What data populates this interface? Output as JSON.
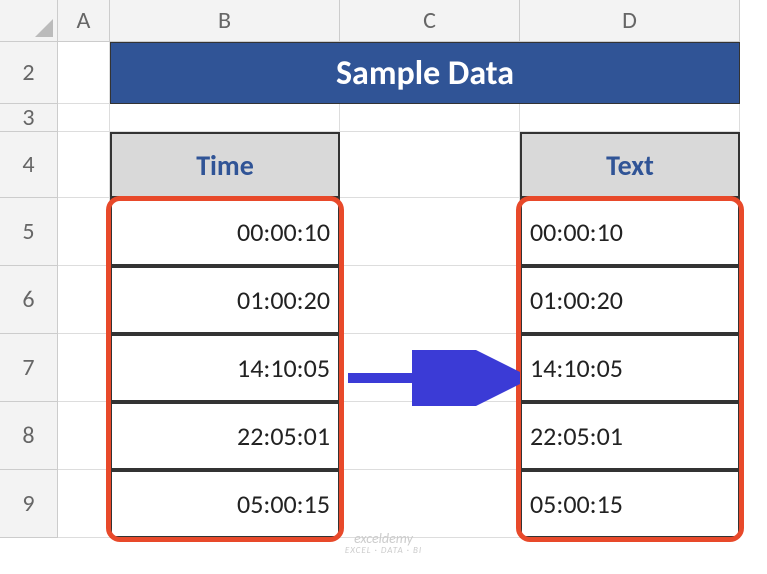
{
  "columns": [
    "A",
    "B",
    "C",
    "D"
  ],
  "rows": [
    "2",
    "3",
    "4",
    "5",
    "6",
    "7",
    "8",
    "9"
  ],
  "title": "Sample Data",
  "headers": {
    "time": "Time",
    "text": "Text"
  },
  "time_values": [
    "00:00:10",
    "01:00:20",
    "14:10:05",
    "22:05:01",
    "05:00:15"
  ],
  "text_values": [
    "00:00:10",
    "01:00:20",
    "14:10:05",
    "22:05:01",
    "05:00:15"
  ],
  "watermark": {
    "line1": "exceldemy",
    "line2": "EXCEL · DATA · BI"
  },
  "col_widths": {
    "A": 52,
    "B": 230,
    "C": 180,
    "D": 220
  },
  "row_heights": {
    "2": 62,
    "3": 28,
    "4": 66,
    "5": 68,
    "6": 68,
    "7": 68,
    "8": 68,
    "9": 68
  }
}
